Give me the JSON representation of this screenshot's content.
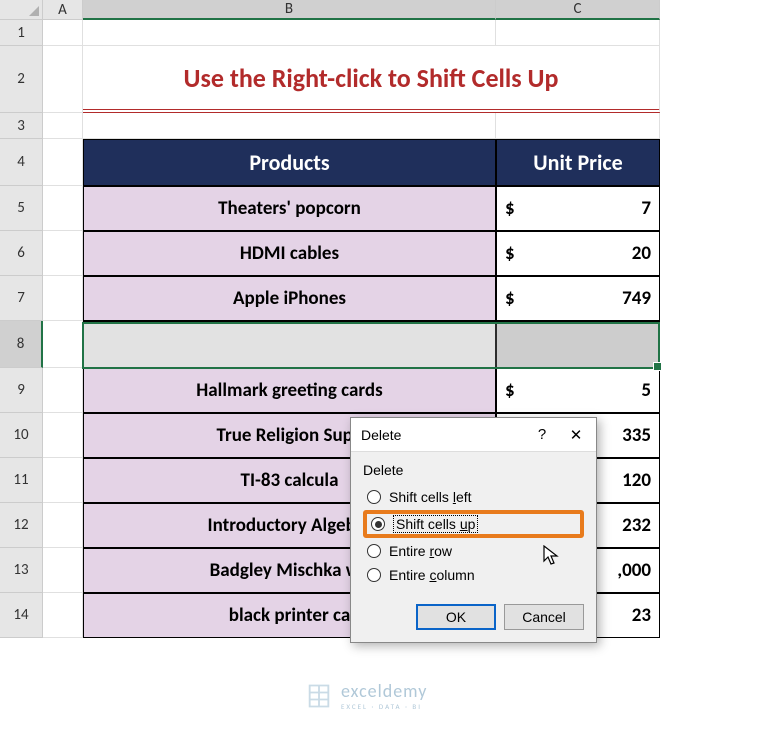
{
  "columns": [
    "A",
    "B",
    "C"
  ],
  "rows": [
    "1",
    "2",
    "3",
    "4",
    "5",
    "6",
    "7",
    "8",
    "9",
    "10",
    "11",
    "12",
    "13",
    "14"
  ],
  "title": "Use the Right-click to Shift Cells Up",
  "headers": {
    "products": "Products",
    "price": "Unit Price"
  },
  "currency": "$",
  "products": [
    {
      "name": "Theaters' popcorn",
      "price": "7"
    },
    {
      "name": "HDMI cables",
      "price": "20"
    },
    {
      "name": "Apple iPhones",
      "price": "749"
    },
    {
      "name": "",
      "price": ""
    },
    {
      "name": "Hallmark greeting cards",
      "price": "5"
    },
    {
      "name": "True Religion Supe",
      "price": "335"
    },
    {
      "name": "TI-83 calcula",
      "price": "120"
    },
    {
      "name": "Introductory Algebra",
      "price": "232"
    },
    {
      "name": "Badgley Mischka we",
      "price": ",000"
    },
    {
      "name": "black printer ca",
      "price": "23"
    }
  ],
  "dialog": {
    "title": "Delete",
    "group_label": "Delete",
    "options": {
      "left": {
        "pre": "Shift cells ",
        "u": "l",
        "post": "eft"
      },
      "up": {
        "pre": "Shift cells ",
        "u": "u",
        "post": "p"
      },
      "row": {
        "pre": "Entire ",
        "u": "r",
        "post": "ow"
      },
      "col": {
        "pre": "Entire ",
        "u": "c",
        "post": "olumn"
      }
    },
    "ok": "OK",
    "cancel": "Cancel",
    "help": "?",
    "close": "✕"
  },
  "watermark": {
    "name": "exceldemy",
    "sub": "EXCEL · DATA · BI"
  }
}
